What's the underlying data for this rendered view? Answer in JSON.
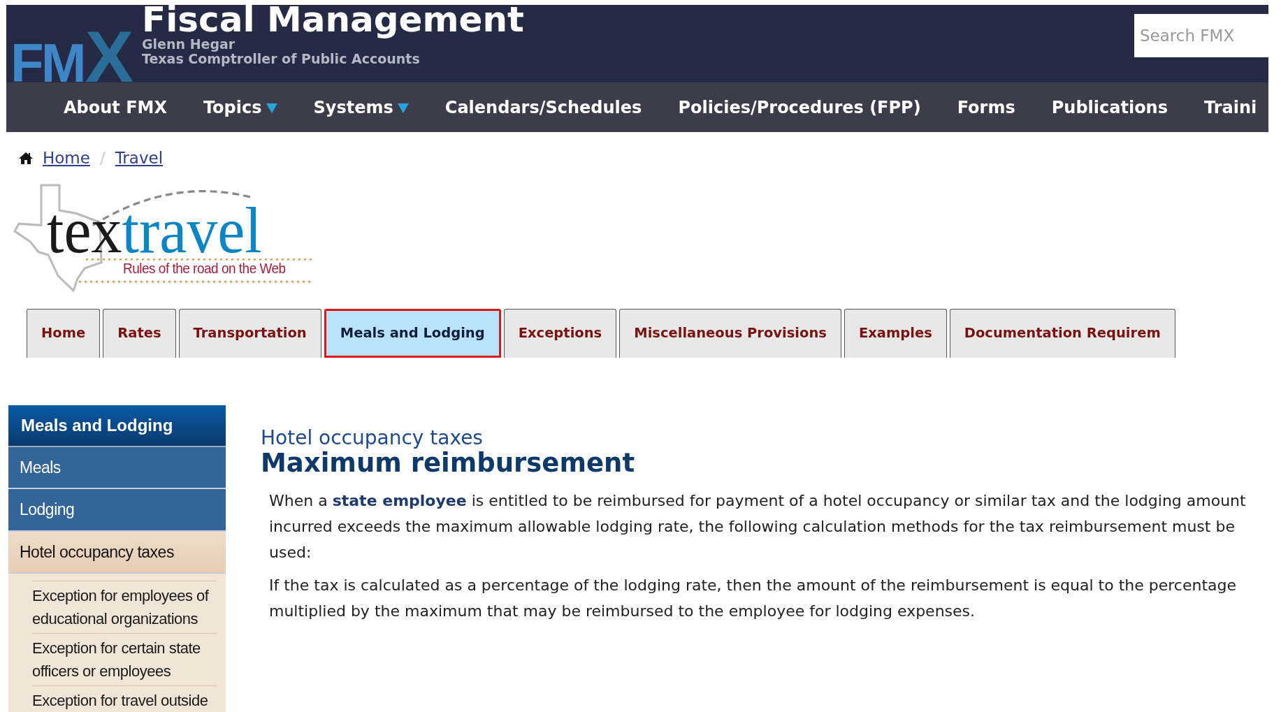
{
  "header": {
    "logo": "FMX",
    "title": "Fiscal Management",
    "subtitle_lines": [
      "Glenn Hegar",
      "Texas Comptroller of Public Accounts"
    ],
    "search": {
      "placeholder": "Search FMX"
    }
  },
  "nav": [
    {
      "label": "About FMX",
      "dropdown": false
    },
    {
      "label": "Topics",
      "dropdown": true
    },
    {
      "label": "Systems",
      "dropdown": true
    },
    {
      "label": "Calendars/Schedules",
      "dropdown": false
    },
    {
      "label": "Policies/Procedures (FPP)",
      "dropdown": false
    },
    {
      "label": "Forms",
      "dropdown": false
    },
    {
      "label": "Publications",
      "dropdown": false
    },
    {
      "label": "Traini",
      "dropdown": false
    }
  ],
  "breadcrumb": {
    "separator": "/",
    "items": [
      "Home",
      "Travel"
    ]
  },
  "logo": {
    "part_1": "tex",
    "part_2": "travel",
    "tagline": "Rules of the road on the Web"
  },
  "tabs": [
    {
      "label": "Home",
      "selected": false
    },
    {
      "label": "Rates",
      "selected": false
    },
    {
      "label": "Transportation",
      "selected": false
    },
    {
      "label": "Meals and Lodging",
      "selected": true
    },
    {
      "label": "Exceptions",
      "selected": false
    },
    {
      "label": "Miscellaneous Provisions",
      "selected": false
    },
    {
      "label": "Examples",
      "selected": false
    },
    {
      "label": "Documentation Requirem",
      "selected": false
    }
  ],
  "sidebar": {
    "title": "Meals and Lodging",
    "items": [
      {
        "label": "Meals",
        "selected": false
      },
      {
        "label": "Lodging",
        "selected": false
      },
      {
        "label": "Hotel occupancy taxes",
        "selected": true,
        "children": [
          {
            "label": "Exception for employees of educational organizations"
          },
          {
            "label": "Exception for certain state officers or employees"
          },
          {
            "label": "Exception for travel outside"
          }
        ]
      }
    ]
  },
  "content": {
    "section": "Hotel occupancy taxes",
    "title": "Maximum reimbursement",
    "paragraphs": [
      "When a **state employee** is entitled to be reimbursed for payment of a hotel occupancy or similar tax and the lodging amount incurred exceeds the maximum allowable lodging rate, the following calculation methods for the tax reimbursement must be used:",
      "If the tax is calculated as a percentage of the lodging rate, then the amount of the reimbursement is equal to the percentage multiplied by the maximum that may be reimbursed to the employee for lodging expenses."
    ]
  }
}
